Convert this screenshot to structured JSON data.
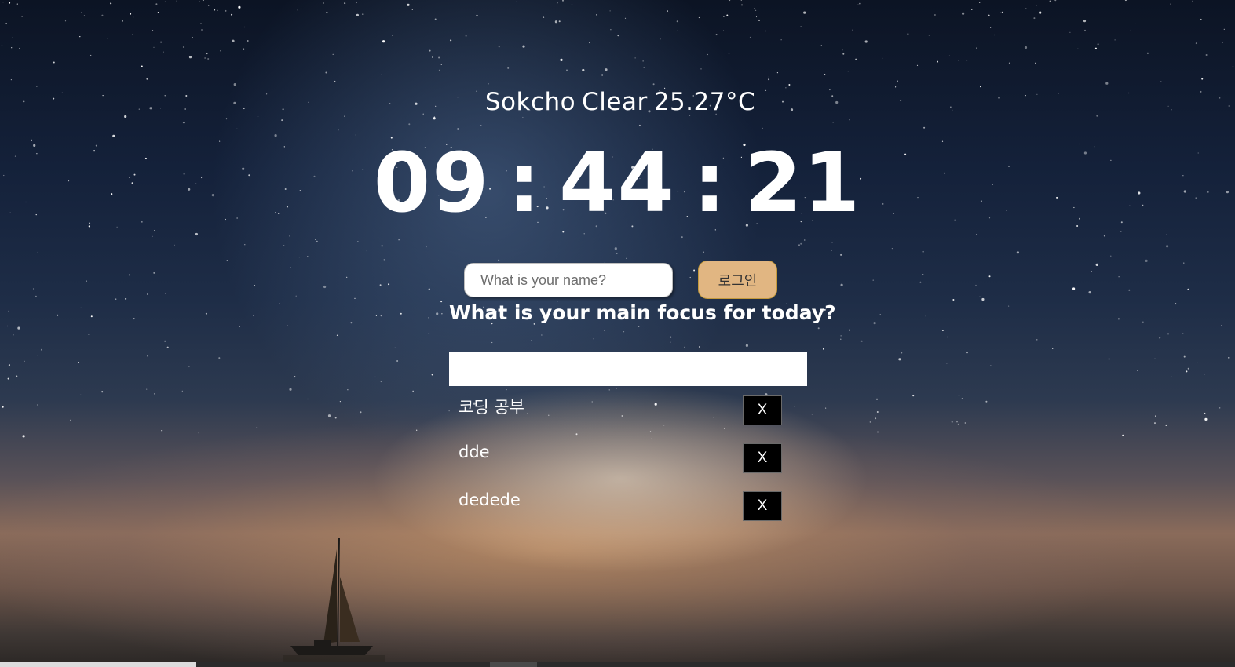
{
  "weather": {
    "city": "Sokcho",
    "condition": "Clear",
    "temperature": "25.27°C"
  },
  "clock": {
    "hours": "09",
    "separator": ":",
    "minutes": "44",
    "seconds": "21"
  },
  "login": {
    "name_placeholder": "What is your name?",
    "name_value": "",
    "button_label": "로그인",
    "button_color": "#e1b682"
  },
  "focus": {
    "title": "What is your main focus for today?",
    "input_value": ""
  },
  "todos": {
    "items": [
      {
        "text": "코딩 공부",
        "delete_label": "X"
      },
      {
        "text": "dde",
        "delete_label": "X"
      },
      {
        "text": "dedede",
        "delete_label": "X"
      }
    ]
  },
  "background": {
    "image": "night-sky-sailboat"
  }
}
